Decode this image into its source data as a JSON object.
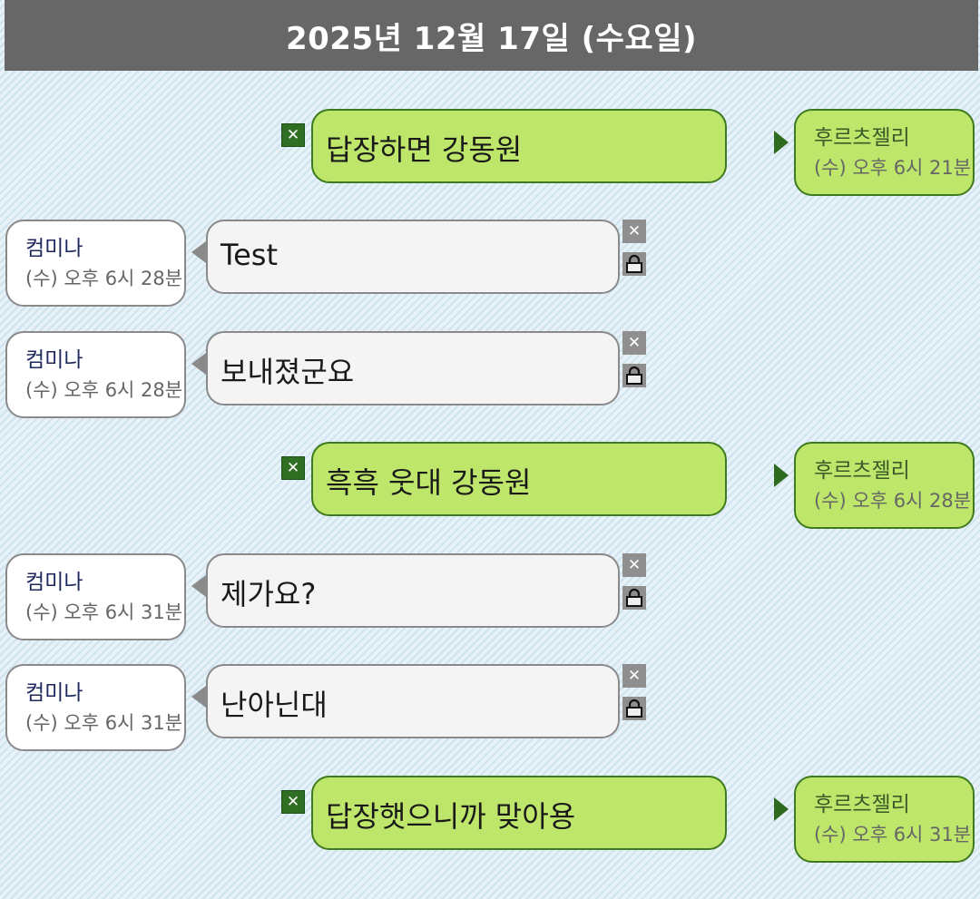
{
  "date_header": "2025년 12월 17일 (수요일)",
  "messages": [
    {
      "direction": "out",
      "text": "답장하면 강동원",
      "sender": "후르츠젤리",
      "time": "(수) 오후 6시 21분"
    },
    {
      "direction": "in",
      "text": "Test",
      "sender": "컴미나",
      "time": "(수) 오후 6시 28분"
    },
    {
      "direction": "in",
      "text": "보내졌군요",
      "sender": "컴미나",
      "time": "(수) 오후 6시 28분"
    },
    {
      "direction": "out",
      "text": "흑흑 웃대 강동원",
      "sender": "후르츠젤리",
      "time": "(수) 오후 6시 28분"
    },
    {
      "direction": "in",
      "text": "제가요?",
      "sender": "컴미나",
      "time": "(수) 오후 6시 31분"
    },
    {
      "direction": "in",
      "text": "난아닌대",
      "sender": "컴미나",
      "time": "(수) 오후 6시 31분"
    },
    {
      "direction": "out",
      "text": "답장햇으니까 맞아용",
      "sender": "후르츠젤리",
      "time": "(수) 오후 6시 31분"
    }
  ],
  "icons": {
    "delete": "close-icon",
    "lock": "lock-icon",
    "send_arrow": "triangle-right-icon",
    "receive_arrow": "triangle-left-icon"
  },
  "colors": {
    "header_bg": "#676767",
    "out_bubble": "#bde66a",
    "out_border": "#3e7a1f",
    "in_bubble": "#f4f4f4",
    "in_border": "#8a8a8a"
  }
}
